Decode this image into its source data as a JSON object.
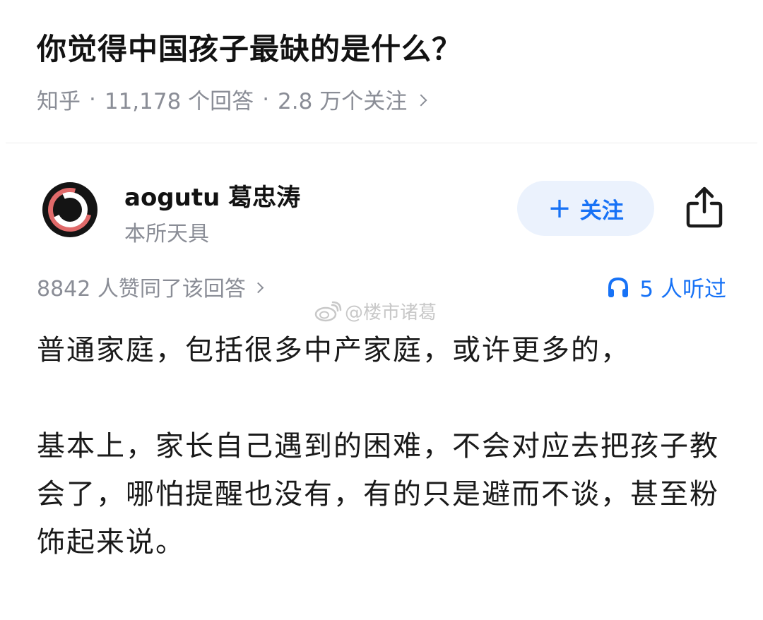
{
  "question": {
    "title": "你觉得中国孩子最缺的是什么？",
    "source": "知乎",
    "sep": "·",
    "answers_count": "11,178 个回答",
    "followers_count": "2.8 万个关注"
  },
  "author": {
    "name": "aogutu 葛忠涛",
    "bio": "本所天具",
    "avatar_icon": "avatar-logo-icon",
    "follow_label": "关注",
    "follow_plus": "+",
    "share_icon": "share-icon"
  },
  "stats": {
    "upvotes": "8842 人赞同了该回答",
    "listen_icon": "headphones-icon",
    "listen": "5 人听过"
  },
  "watermark": {
    "icon": "weibo-icon",
    "text": "@楼市诸葛"
  },
  "answer": {
    "paragraphs": [
      "普通家庭，包括很多中产家庭，或许更多的，",
      "基本上，家长自己遇到的困难，不会对应去把孩子教会了，哪怕提醒也没有，有的只是避而不谈，甚至粉饰起来说。"
    ]
  },
  "colors": {
    "accent": "#1772f6",
    "follow_bg": "#ebf2fd",
    "meta_gray": "#8a8d96",
    "text": "#1a1a1a"
  }
}
